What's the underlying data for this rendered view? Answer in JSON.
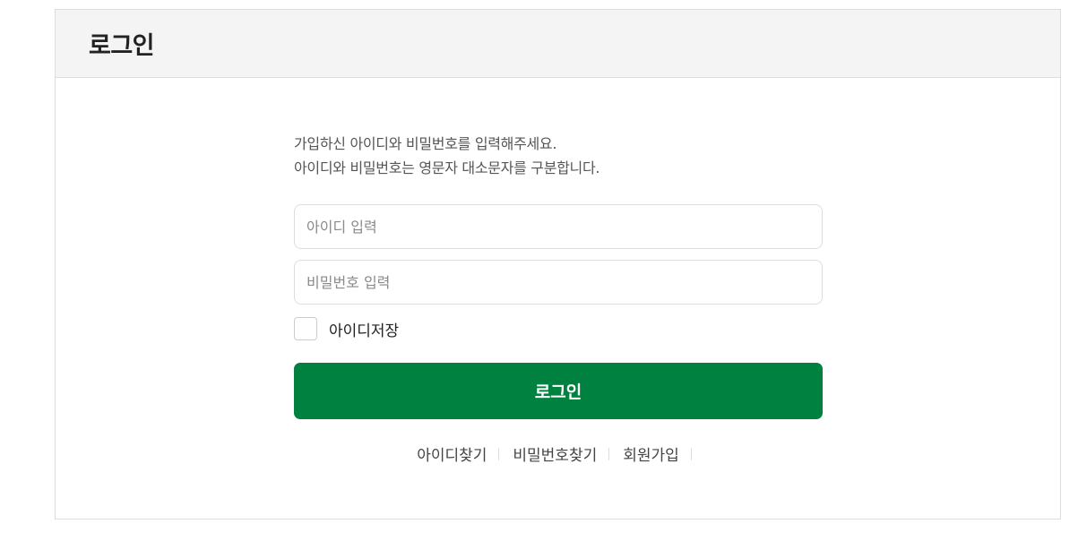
{
  "header": {
    "title": "로그인"
  },
  "form": {
    "desc_line1": "가입하신 아이디와 비밀번호를 입력해주세요.",
    "desc_line2": "아이디와 비밀번호는 영문자 대소문자를 구분합니다.",
    "id_placeholder": "아이디 입력",
    "id_value": "",
    "pw_placeholder": "비밀번호 입력",
    "pw_value": "",
    "save_id_label": "아이디저장",
    "save_id_checked": false,
    "login_button": "로그인"
  },
  "links": {
    "find_id": "아이디찾기",
    "find_pw": "비밀번호찾기",
    "signup": "회원가입"
  },
  "colors": {
    "accent": "#00813f",
    "header_bg": "#f4f4f4",
    "border": "#dddddd"
  }
}
